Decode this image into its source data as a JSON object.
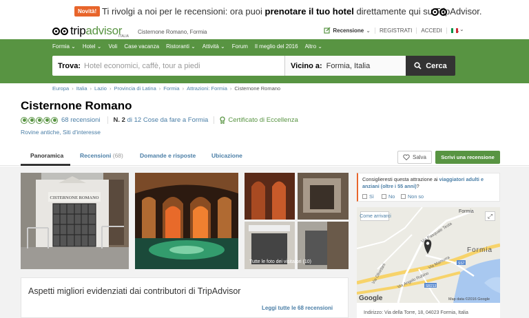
{
  "banner": {
    "badge": "Novità!",
    "text_pre": "Ti rivolgi a noi per le recensioni: ora puoi ",
    "text_bold": "prenotare il tuo hotel",
    "text_post": " direttamente qui su TripAdvisor."
  },
  "header": {
    "logo_trip": "trip",
    "logo_advisor": "advisor",
    "logo_sub": "ITALIA",
    "location": "Cisternone Romano, Formia",
    "recensione": "Recensione",
    "registrati": "REGISTRATI",
    "accedi": "ACCEDI",
    "currency": "€"
  },
  "nav": {
    "items": [
      "Formia",
      "Hotel",
      "Voli",
      "Case vacanza",
      "Ristoranti",
      "Attività",
      "Forum",
      "Il meglio del 2016",
      "Altro"
    ]
  },
  "search": {
    "trova_label": "Trova:",
    "trova_placeholder": "Hotel economici, caffè, tour a piedi",
    "vicino_label": "Vicino a:",
    "vicino_value": "Formia, Italia",
    "button": "Cerca"
  },
  "breadcrumb": [
    "Europa",
    "Italia",
    "Lazio",
    "Provincia di Latina",
    "Formia",
    "Attrazioni: Formia",
    "Cisternone Romano"
  ],
  "attraction": {
    "title": "Cisternone Romano",
    "rating": 5,
    "reviews": "68 recensioni",
    "rank_no": "N. 2",
    "rank_rest": " di 12 Cose da fare a Formia",
    "certificate": "Certificato di Eccellenza",
    "categories": "Rovine antiche, Siti d'interesse"
  },
  "tabs": {
    "panoramica": "Panoramica",
    "recensioni": "Recensioni",
    "recensioni_count": "(68)",
    "domande": "Domande e risposte",
    "ubicazione": "Ubicazione",
    "salva": "Salva",
    "scrivi": "Scrivi una recensione"
  },
  "photos": {
    "all_label": "Tutte le foto dei visitatori",
    "all_count": "(10)",
    "sign_text": "CISTERNONE ROMANO"
  },
  "aspects": {
    "title": "Aspetti migliori evidenziati dai contributori di TripAdvisor",
    "link": "Leggi tutte le 68 recensioni"
  },
  "sidebar": {
    "question_pre": "Consiglieresti questa attrazione ai ",
    "question_link": "viaggiatori adulti e anziani (oltre i 55 anni)",
    "question_post": "?",
    "options": [
      "Sì",
      "No",
      "Non so"
    ],
    "map_button": "Come arrivarci",
    "map_labels": {
      "formia_top": "Formia",
      "formia_city": "Formia",
      "via_pasquale": "Via Pasquale Testa",
      "via_olivetani": "Via Olivetani",
      "via_mamurra": "Via Mamurra",
      "via_rubino": "Via Angelo Rubino",
      "ss7": "SS7",
      "sr213": "SR213",
      "google": "Google",
      "copyright": "Map data ©2016 Google"
    },
    "address": "Indirizzo: Via della Torre, 18, 04023 Formia, Italia"
  },
  "colors": {
    "green": "#589442",
    "orange": "#e8652b",
    "link": "#4a7ea6"
  }
}
